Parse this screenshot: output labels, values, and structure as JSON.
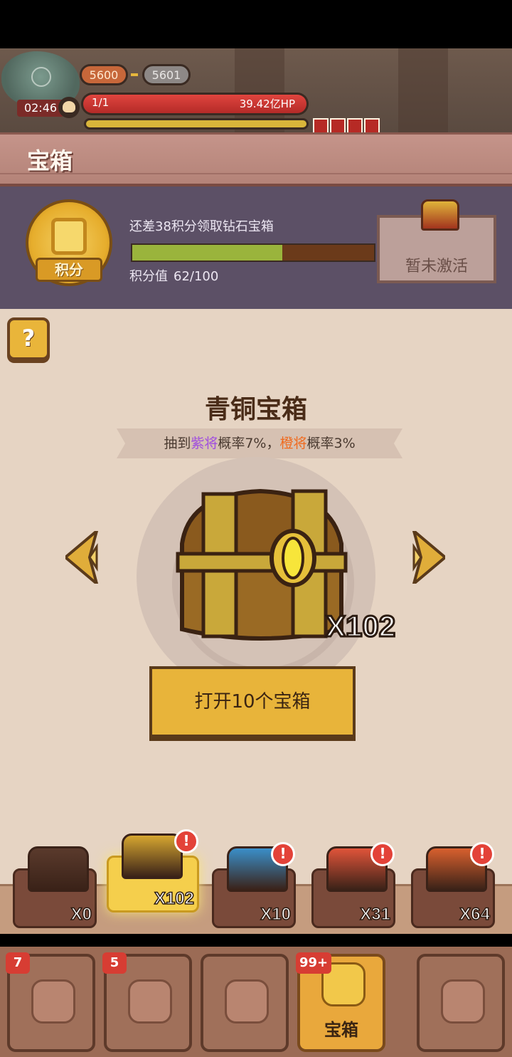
{
  "battle": {
    "left_score": "5600",
    "right_score": "5601",
    "timer": "02:46",
    "wave": "1/1",
    "hp": "39.42亿HP",
    "hp_fraction": 1.0,
    "charge_fraction": 1.0,
    "buffs": [
      "attack-up-icon",
      "attack-up-icon",
      "spiral-icon",
      "fire-icon"
    ]
  },
  "header": {
    "title": "宝箱"
  },
  "points": {
    "medal_label": "积分",
    "hint": "还差38积分领取钻石宝箱",
    "value_label": "积分值",
    "value": "62/100",
    "progress_fraction": 0.62,
    "reward_status": "暂未激活"
  },
  "main": {
    "help_label": "?",
    "chest_name": "青铜宝箱",
    "odds": {
      "prefix": "抽到",
      "purple_name": "紫将",
      "purple_rate": "概率7%，",
      "orange_name": "橙将",
      "orange_rate": "概率3%"
    },
    "chest_count": "X102",
    "open_button": "打开10个宝箱"
  },
  "shelf": [
    {
      "count": "X0",
      "color": "#5a3a2c",
      "alert": false,
      "selected": false
    },
    {
      "count": "X102",
      "color": "#d6a630",
      "alert": true,
      "selected": true
    },
    {
      "count": "X10",
      "color": "#3a8fc9",
      "alert": true,
      "selected": false
    },
    {
      "count": "X31",
      "color": "#e0543a",
      "alert": true,
      "selected": false
    },
    {
      "count": "X64",
      "color": "#d8602e",
      "alert": true,
      "selected": false
    }
  ],
  "nav": [
    {
      "badge": "7",
      "label": "",
      "active": false,
      "icon": "rock-icon"
    },
    {
      "badge": "5",
      "label": "",
      "active": false,
      "icon": "armor-icon"
    },
    {
      "badge": "",
      "label": "",
      "active": false,
      "icon": "helmet-icon"
    },
    {
      "badge": "99+",
      "label": "宝箱",
      "active": true,
      "icon": "chest-icon"
    },
    {
      "badge": "",
      "label": "",
      "active": false,
      "icon": "scroll-icon"
    }
  ],
  "colors": {
    "accent": "#e8b43a",
    "panel": "#5c5066",
    "main_bg": "#e6d4c3"
  }
}
